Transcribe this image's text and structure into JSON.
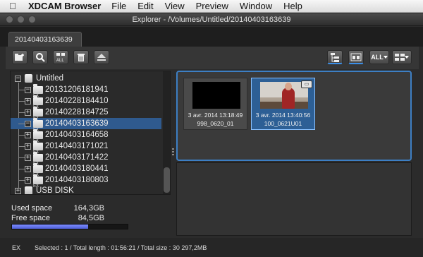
{
  "menubar": {
    "app": "XDCAM Browser",
    "items": [
      "File",
      "Edit",
      "View",
      "Preview",
      "Window",
      "Help"
    ]
  },
  "window": {
    "title": "Explorer - /Volumes/Untitled/20140403163639"
  },
  "tab": {
    "label": "20140403163639"
  },
  "toolbar": {
    "left_icons": [
      "new-folder-icon",
      "search-icon",
      "select-all-icon",
      "trash-icon",
      "eject-icon"
    ],
    "right_icons": [
      "tree-view-icon",
      "clip-view-icon",
      "all-filter-icon",
      "thumbnail-layout-icon"
    ],
    "all_label": "ALL"
  },
  "tree": {
    "items": [
      {
        "label": "Untitled",
        "type": "disk",
        "level": 0,
        "expanded": true
      },
      {
        "label": "20131206181941",
        "type": "folder",
        "level": 1,
        "expanded": true
      },
      {
        "label": "20140228184410",
        "type": "folder",
        "level": 1,
        "expanded": false
      },
      {
        "label": "20140228184725",
        "type": "folder",
        "level": 1,
        "expanded": false
      },
      {
        "label": "20140403163639",
        "type": "folder",
        "level": 1,
        "expanded": true,
        "selected": true
      },
      {
        "label": "20140403164658",
        "type": "folder",
        "level": 1,
        "expanded": false
      },
      {
        "label": "20140403171021",
        "type": "folder",
        "level": 1,
        "expanded": false
      },
      {
        "label": "20140403171422",
        "type": "folder",
        "level": 1,
        "expanded": false
      },
      {
        "label": "20140403180441",
        "type": "folder",
        "level": 1,
        "expanded": false
      },
      {
        "label": "20140403180803",
        "type": "folder",
        "level": 1,
        "expanded": false
      },
      {
        "label": "USB DISK",
        "type": "disk",
        "level": 0,
        "expanded": false
      }
    ],
    "folder_badge": "EX"
  },
  "space": {
    "used_label": "Used space",
    "used_value": "164,3GB",
    "free_label": "Free space",
    "free_value": "84,5GB",
    "used_fraction": 0.66
  },
  "clips": [
    {
      "date": "3 avr. 2014 13:18:49",
      "name": "998_0620_01",
      "selected": false,
      "thumbnail": "black"
    },
    {
      "date": "3 avr. 2014 13:40:56",
      "name": "100_0621U01",
      "selected": true,
      "thumbnail": "speaker"
    }
  ],
  "status": {
    "format": "EX",
    "text": "Selected : 1 / Total length : 01:56:21 / Total size : 30 297,2MB"
  }
}
